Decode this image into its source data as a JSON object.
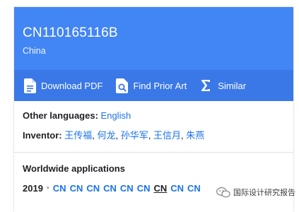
{
  "colors": {
    "header_bg": "#4285f4",
    "toolbar_bg": "#3b78e7",
    "link": "#1a73e8"
  },
  "header": {
    "patent_number": "CN110165116B",
    "country": "China"
  },
  "toolbar": {
    "download_pdf": "Download PDF",
    "find_prior_art": "Find Prior Art",
    "similar": "Similar"
  },
  "meta": {
    "other_languages_label": "Other languages:",
    "other_languages_value": "English",
    "inventor_label": "Inventor:",
    "inventors": [
      "王传福",
      "何龙",
      "孙华军",
      "王信月",
      "朱燕"
    ]
  },
  "worldwide": {
    "title": "Worldwide applications",
    "year": "2019",
    "codes": [
      "CN",
      "CN",
      "CN",
      "CN",
      "CN",
      "CN",
      "CN",
      "CN",
      "CN"
    ],
    "current_index": 6
  },
  "watermark": {
    "text": "国际设计研究报告"
  }
}
